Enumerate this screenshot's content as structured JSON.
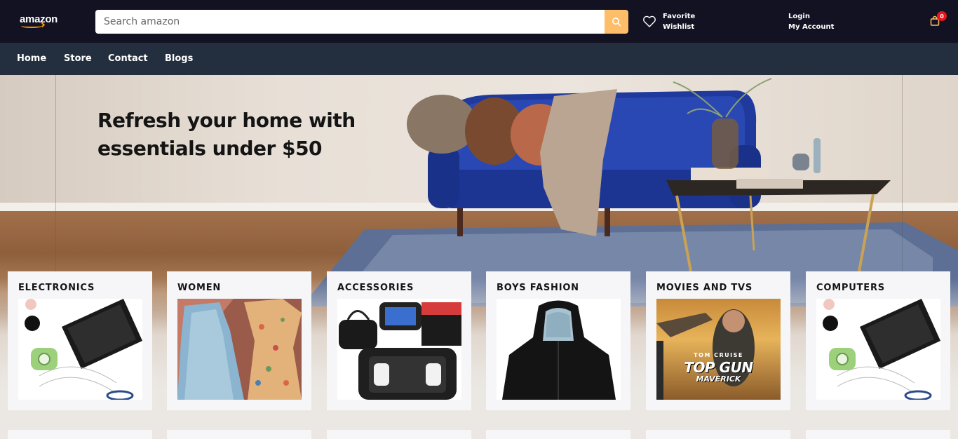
{
  "header": {
    "logo_text": "amazon",
    "search_placeholder": "Search amazon",
    "wishlist": {
      "line1": "Favorite",
      "line2": "Wishlist"
    },
    "account": {
      "line1": "Login",
      "line2": "My Account"
    },
    "cart_count": "0",
    "accent_color": "#febd69",
    "bg_color": "#131222"
  },
  "nav": {
    "items": [
      "Home",
      "Store",
      "Contact",
      "Blogs"
    ],
    "bg_color": "#232f3e"
  },
  "hero": {
    "title_line1": "Refresh your home with",
    "title_line2": "essentials under $50"
  },
  "categories": [
    {
      "title": "ELECTRONICS"
    },
    {
      "title": "WOMEN"
    },
    {
      "title": "ACCESSORIES"
    },
    {
      "title": "BOYS FASHION"
    },
    {
      "title": "MOVIES AND TVS"
    },
    {
      "title": "COMPUTERS"
    }
  ],
  "movie_poster": {
    "actor": "TOM CRUISE",
    "title": "TOP GUN",
    "subtitle": "MAVERICK"
  }
}
